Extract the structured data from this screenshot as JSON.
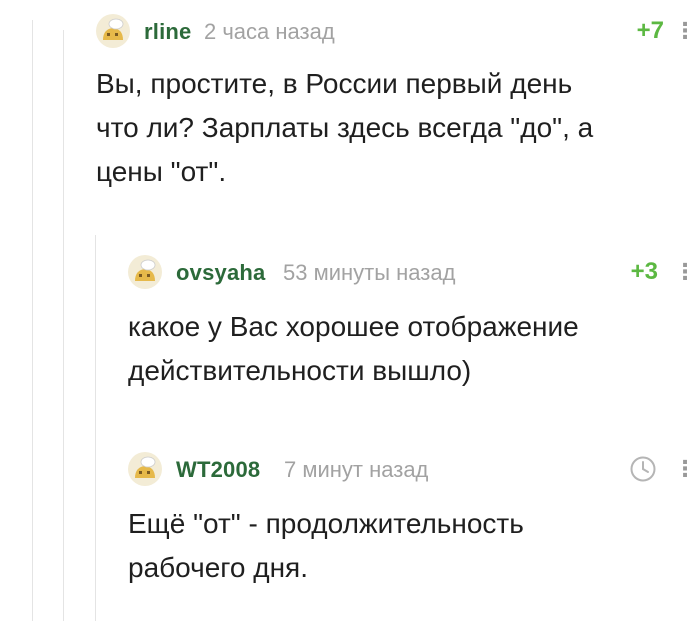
{
  "comments": [
    {
      "username": "rline",
      "time": "2 часа назад",
      "rating": "+7",
      "text_lines": [
        "Вы, простите, в России первый день",
        "что ли? Зарплаты здесь всегда \"до\", а",
        "цены \"от\"."
      ]
    },
    {
      "username": "ovsyaha",
      "time": "53 минуты назад",
      "rating": "+3",
      "text_lines": [
        "какое у Вас хорошее отображение",
        "действительности вышло)"
      ]
    },
    {
      "username": "WT2008",
      "time": "7 минут назад",
      "rating": "",
      "text_lines": [
        "Ещё \"от\" - продолжительность",
        "рабочего дня."
      ]
    }
  ],
  "icons": {
    "avatar": "cartoon-head-icon",
    "more": "vertical-dots-icon",
    "pending_rating": "clock-icon"
  },
  "colors": {
    "username": "#2c6a3a",
    "time": "#a2a2a2",
    "rating": "#5cb842",
    "thread_line": "#e4e4e4"
  }
}
